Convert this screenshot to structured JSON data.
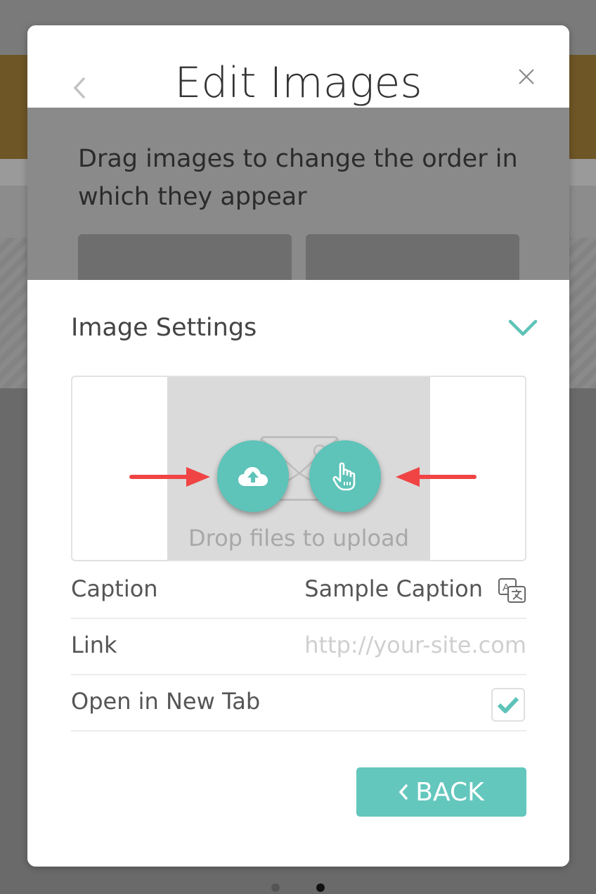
{
  "modal": {
    "title": "Edit Images",
    "gallery_instruction": "Drag images to change the order in which they appear"
  },
  "settings": {
    "title": "Image Settings",
    "drop_text": "Drop files to upload",
    "caption": {
      "label": "Caption",
      "value": "Sample Caption"
    },
    "link": {
      "label": "Link",
      "placeholder": "http://your-site.com"
    },
    "new_tab": {
      "label": "Open in New Tab",
      "checked": true
    },
    "back_label": "BACK"
  },
  "pagination": {
    "count": 2,
    "active_index": 1
  },
  "colors": {
    "accent": "#5ec3b8",
    "button": "#64c7bd",
    "annotation_arrow": "#f04444"
  },
  "icons": [
    "back-chevron-icon",
    "close-icon",
    "chevron-down-icon",
    "cloud-upload-icon",
    "hand-pointer-icon",
    "translate-icon",
    "checkmark-icon",
    "arrow-right-icon",
    "arrow-left-icon"
  ]
}
